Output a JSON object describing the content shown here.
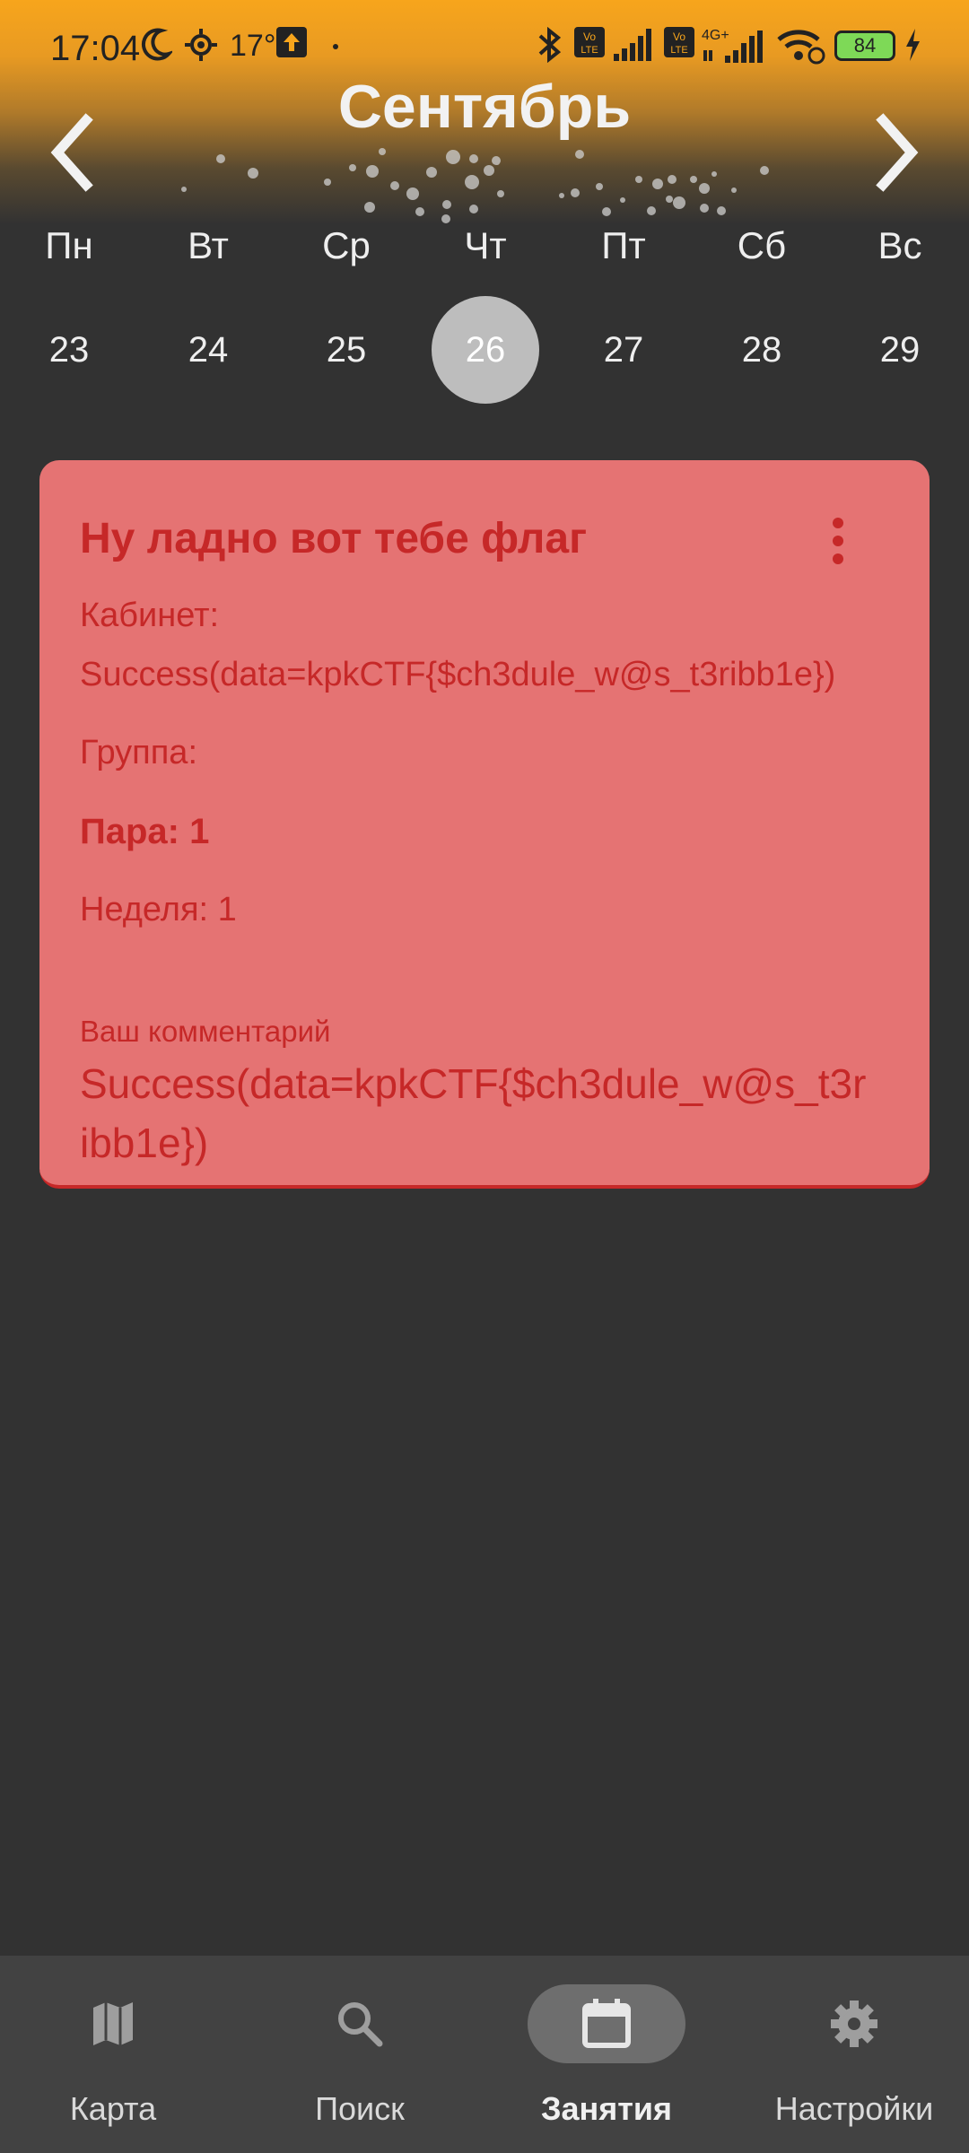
{
  "status_bar": {
    "time": "17:04",
    "temperature": "17°",
    "battery_level": "84"
  },
  "calendar": {
    "month": "Сентябрь",
    "weekdays": [
      "Пн",
      "Вт",
      "Ср",
      "Чт",
      "Пт",
      "Сб",
      "Вс"
    ],
    "dates": [
      "23",
      "24",
      "25",
      "26",
      "27",
      "28",
      "29"
    ],
    "selected_date": "26"
  },
  "card": {
    "title": "Ну ладно вот тебе флаг",
    "room_label": "Кабинет:",
    "room_value": "Success(data=kpkCTF{$ch3dule_w@s_t3ribb1e})",
    "group": "Группа:",
    "pair": "Пара: 1",
    "week": "Неделя: 1",
    "comment_label": "Ваш комментарий",
    "comment_value": "Success(data=kpkCTF{$ch3dule_w@s_t3ribb1e})"
  },
  "bottom_nav": [
    {
      "label": "Карта",
      "icon": "map-icon",
      "active": false
    },
    {
      "label": "Поиск",
      "icon": "search-icon",
      "active": false
    },
    {
      "label": "Занятия",
      "icon": "calendar-icon",
      "active": true
    },
    {
      "label": "Настройки",
      "icon": "gear-icon",
      "active": false
    }
  ],
  "colors": {
    "background": "#323232",
    "header_accent": "#f7a51c",
    "card_bg": "#e57373",
    "card_text": "#c62828",
    "nav_bg": "#424242",
    "selected_date": "#bdbdbd"
  }
}
